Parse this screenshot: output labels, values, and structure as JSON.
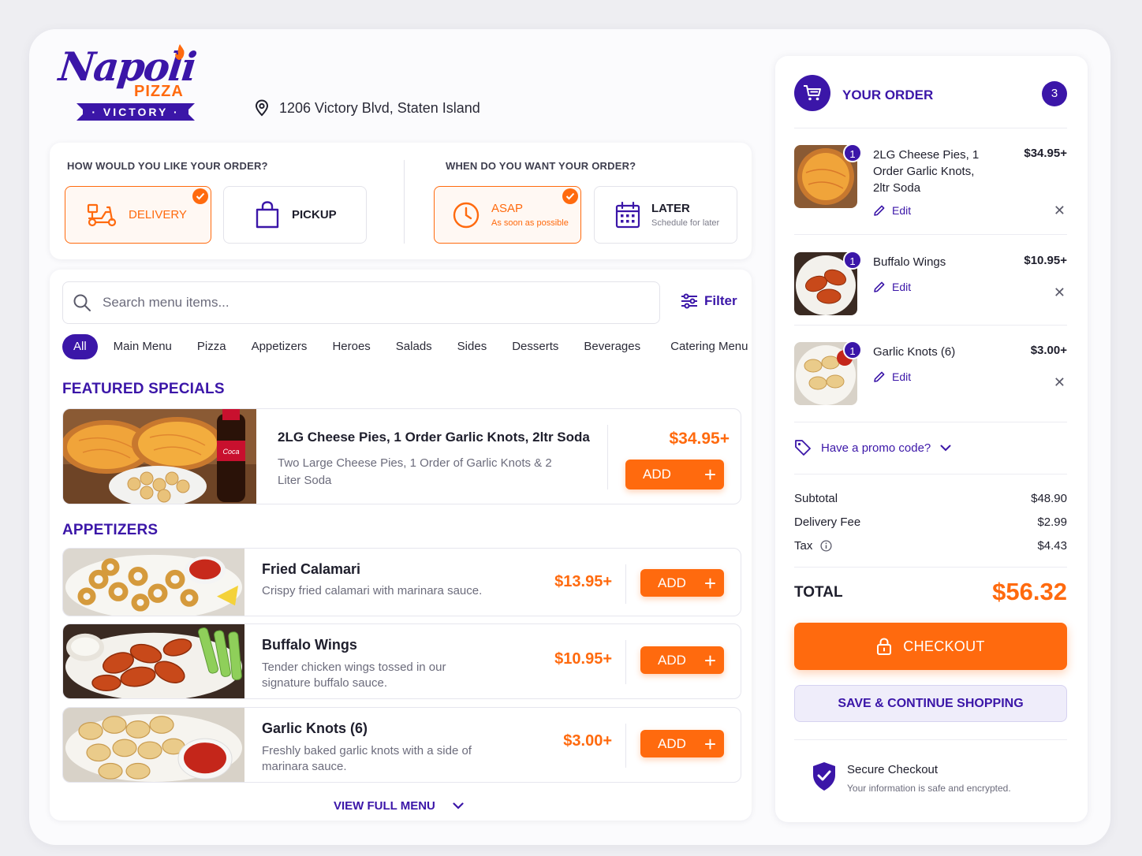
{
  "brand": {
    "logo_script": "Napoli",
    "logo_sub": "PIZZA",
    "logo_banner": "· VICTORY ·"
  },
  "header": {
    "address": "1206 Victory Blvd, Staten Island",
    "icon": "location-pin-icon"
  },
  "order_options": {
    "method_heading": "HOW WOULD YOU LIKE YOUR ORDER?",
    "time_heading": "WHEN DO YOU WANT YOUR ORDER?",
    "delivery_label": "DELIVERY",
    "pickup_label": "PICKUP",
    "asap_label": "ASAP",
    "asap_sub": "As soon as possible",
    "later_label": "LATER",
    "later_sub": "Schedule for later",
    "selected_method": "DELIVERY",
    "selected_time": "ASAP"
  },
  "menu": {
    "search_placeholder": "Search menu items...",
    "filter_label": "Filter",
    "categories": [
      "All",
      "Main Menu",
      "Pizza",
      "Appetizers",
      "Heroes",
      "Salads",
      "Sides",
      "Desserts",
      "Beverages",
      "Catering Menu"
    ],
    "active_category": "All",
    "featured_title": "FEATURED SPECIALS",
    "featured": {
      "name": "2LG Cheese Pies, 1 Order Garlic Knots, 2ltr Soda",
      "desc": "Two Large Cheese Pies, 1 Order of Garlic Knots & 2 Liter Soda",
      "price": "$34.95+",
      "add_label": "ADD"
    },
    "appetizers_title": "APPETIZERS",
    "appetizers": [
      {
        "name": "Fried Calamari",
        "desc": "Crispy fried calamari with marinara sauce.",
        "price": "$13.95+",
        "add_label": "ADD"
      },
      {
        "name": "Buffalo Wings",
        "desc": "Tender chicken wings tossed in our signature buffalo sauce.",
        "price": "$10.95+",
        "add_label": "ADD"
      },
      {
        "name": "Garlic Knots (6)",
        "desc": "Freshly baked garlic knots with a side of marinara sauce.",
        "price": "$3.00+",
        "add_label": "ADD"
      }
    ],
    "view_full_label": "VIEW FULL MENU"
  },
  "order": {
    "title": "YOUR ORDER",
    "count": "3",
    "items": [
      {
        "qty": "1",
        "name": "2LG Cheese Pies, 1 Order Garlic Knots, 2ltr Soda",
        "price": "$34.95+",
        "edit": "Edit"
      },
      {
        "qty": "1",
        "name": "Buffalo Wings",
        "price": "$10.95+",
        "edit": "Edit"
      },
      {
        "qty": "1",
        "name": "Garlic Knots (6)",
        "price": "$3.00+",
        "edit": "Edit"
      }
    ],
    "promo_label": "Have a promo code?",
    "subtotal_label": "Subtotal",
    "subtotal": "$48.90",
    "delivery_fee_label": "Delivery Fee",
    "delivery_fee": "$2.99",
    "tax_label": "Tax",
    "tax": "$4.43",
    "total_label": "TOTAL",
    "total": "$56.32",
    "checkout_label": "CHECKOUT",
    "save_label": "SAVE & CONTINUE SHOPPING",
    "secure_title": "Secure Checkout",
    "secure_sub": "Your information is safe and encrypted."
  },
  "colors": {
    "brand_purple": "#3b16a8",
    "accent_orange": "#ff6a0e"
  }
}
